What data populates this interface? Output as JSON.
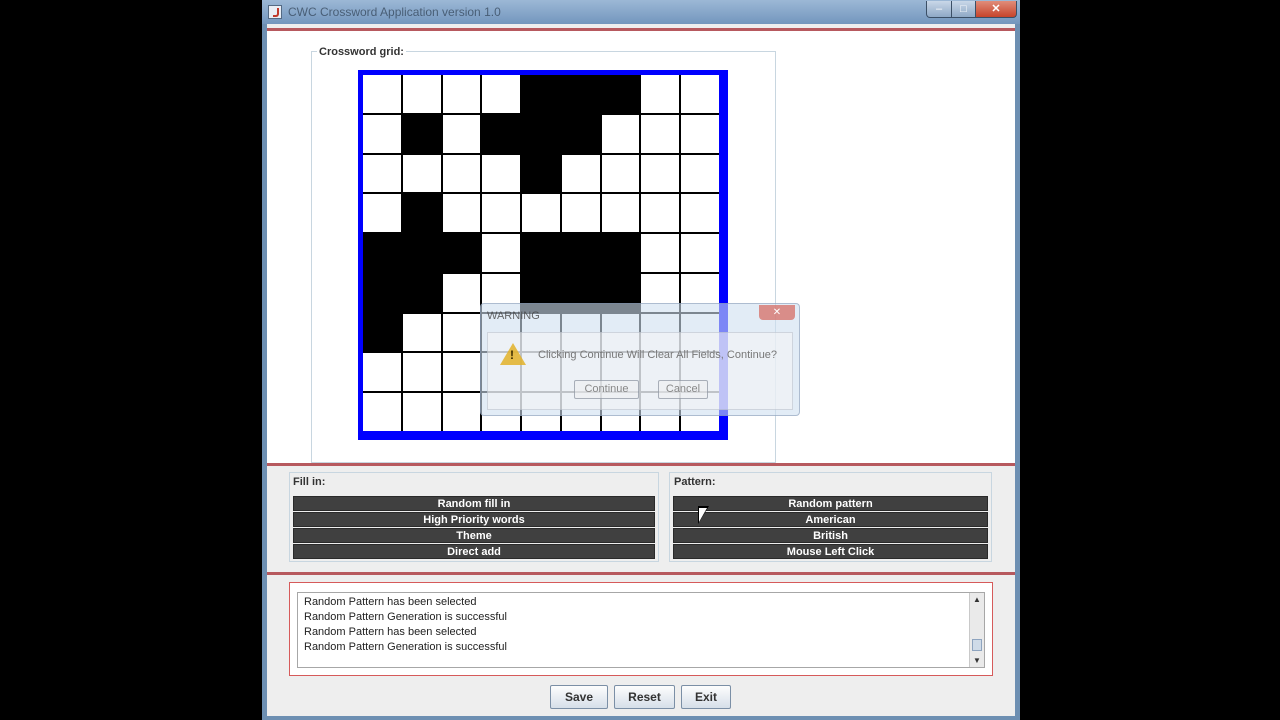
{
  "window": {
    "title": "CWC Crossword Application version 1.0"
  },
  "grid": {
    "label": "Crossword grid:",
    "rows": [
      [
        0,
        0,
        0,
        0,
        1,
        1,
        1,
        0,
        0
      ],
      [
        0,
        1,
        0,
        1,
        1,
        1,
        0,
        0,
        0
      ],
      [
        0,
        0,
        0,
        0,
        1,
        0,
        0,
        0,
        0
      ],
      [
        0,
        1,
        0,
        0,
        0,
        0,
        0,
        0,
        0
      ],
      [
        1,
        1,
        1,
        0,
        1,
        1,
        1,
        0,
        0
      ],
      [
        1,
        1,
        0,
        0,
        1,
        1,
        1,
        0,
        0
      ],
      [
        1,
        0,
        0,
        0,
        0,
        0,
        0,
        0,
        0
      ],
      [
        0,
        0,
        0,
        0,
        0,
        0,
        0,
        0,
        0
      ],
      [
        0,
        0,
        0,
        0,
        0,
        0,
        0,
        0,
        0
      ]
    ]
  },
  "fill_in": {
    "label": "Fill in:",
    "buttons": [
      "Random fill in",
      "High Priority words",
      "Theme",
      "Direct add"
    ]
  },
  "pattern": {
    "label": "Pattern:",
    "buttons": [
      "Random pattern",
      "American",
      "British",
      "Mouse Left Click"
    ]
  },
  "log": {
    "lines": [
      "Random Pattern has been selected",
      "Random Pattern Generation is successful",
      "Random Pattern has been selected",
      "Random Pattern Generation is successful"
    ]
  },
  "bottom": {
    "save": "Save",
    "reset": "Reset",
    "exit": "Exit"
  },
  "dialog": {
    "title": "WARNING",
    "message": "Clicking Continue Will Clear All Fields, Continue?",
    "continue": "Continue",
    "cancel": "Cancel",
    "close_glyph": "✕"
  },
  "glyphs": {
    "minimize": "–",
    "maximize": "□",
    "close": "✕",
    "warning": "!"
  }
}
